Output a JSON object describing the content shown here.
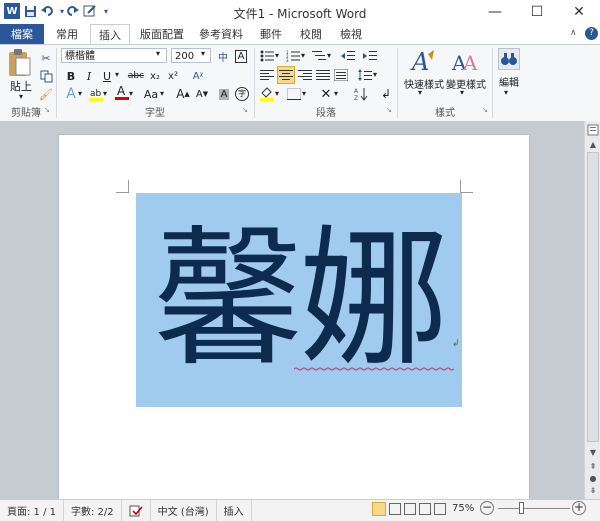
{
  "window": {
    "title": "文件1 - Microsoft Word",
    "controls": {
      "minimize": "—",
      "maximize": "☐",
      "close": "✕"
    }
  },
  "quick_access": {
    "app_icon": "W",
    "save": "💾",
    "undo": "↶",
    "redo": "↺"
  },
  "tabs": {
    "file": "檔案",
    "items": [
      "常用",
      "插入",
      "版面配置",
      "參考資料",
      "郵件",
      "校閱",
      "檢視"
    ],
    "active_index": 1
  },
  "ribbon": {
    "clipboard": {
      "paste_label": "貼上",
      "group_label": "剪貼簿"
    },
    "font": {
      "font_name": "標楷體",
      "font_size": "200",
      "group_label": "字型",
      "bold": "B",
      "italic": "I",
      "underline": "U",
      "strike": "abc",
      "subscript": "x₂",
      "superscript": "x²",
      "font_color": "A",
      "case": "Aa",
      "grow": "A",
      "shrink": "A"
    },
    "paragraph": {
      "group_label": "段落"
    },
    "styles": {
      "quick_styles": "快速樣式",
      "change_styles": "變更樣式",
      "group_label": "樣式"
    },
    "editing": {
      "label": "編輯"
    }
  },
  "document": {
    "text": "馨娜",
    "frame_color": "#a1cbee",
    "text_color": "#0c2b4e"
  },
  "status_bar": {
    "page": "頁面: 1 / 1",
    "words": "字數: 2/2",
    "language": "中文 (台灣)",
    "mode": "插入",
    "zoom": "75%"
  },
  "colors": {
    "accent": "#2b579a",
    "ribbon_bg": "#f6f7f9"
  }
}
